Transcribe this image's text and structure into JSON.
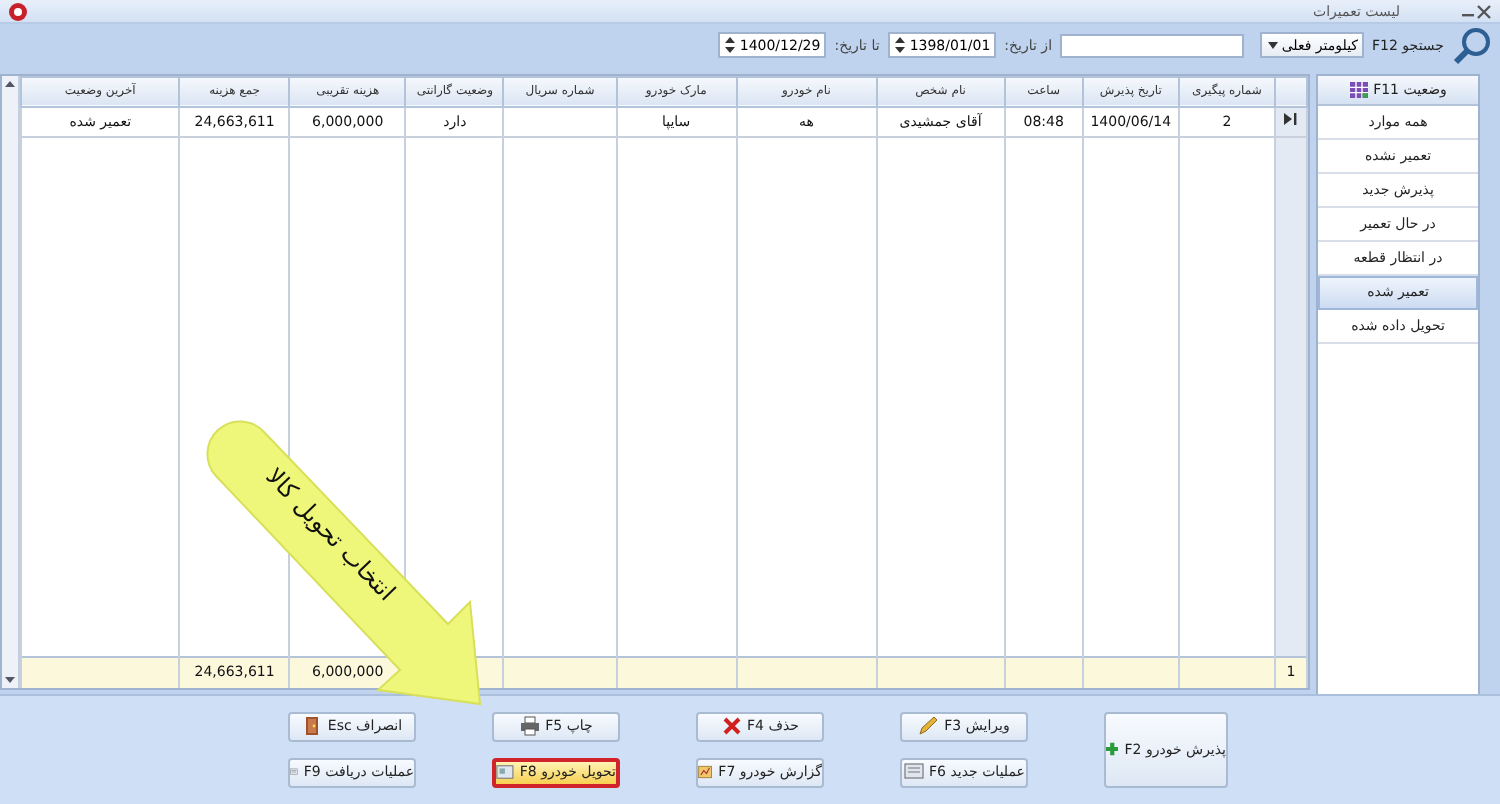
{
  "window": {
    "title": "لیست تعمیرات"
  },
  "toolbar": {
    "search_label": "جستجو F12",
    "filter_field": {
      "value": "کیلومتر فعلی"
    },
    "from_label": "از تاریخ:",
    "from_date": "1398/01/01",
    "to_label": "تا تاریخ:",
    "to_date": "1400/12/29"
  },
  "table": {
    "columns": [
      "شماره پیگیری",
      "تاریخ پذیرش",
      "ساعت",
      "نام شخص",
      "نام خودرو",
      "مارک خودرو",
      "شماره سریال",
      "وضعیت گارانتی",
      "هزینه تقریبی",
      "جمع هزینه",
      "آخرین وضعیت"
    ],
    "rows": [
      {
        "cells": [
          "2",
          "1400/06/14",
          "08:48",
          "آقای جمشیدی",
          "هه",
          "سایپا",
          null,
          "دارد",
          "6,000,000",
          "24,663,611",
          "تعمیر شده"
        ]
      }
    ],
    "totals": {
      "row_count": "1",
      "cells": [
        null,
        null,
        null,
        null,
        null,
        null,
        null,
        null,
        "6,000,000",
        "24,663,611",
        null
      ]
    }
  },
  "sidebar": {
    "title": "وضعیت F11",
    "items": [
      {
        "label": "همه موارد",
        "selected": false
      },
      {
        "label": "تعمیر نشده",
        "selected": false
      },
      {
        "label": "پذیرش جدید",
        "selected": false
      },
      {
        "label": "در حال تعمیر",
        "selected": false
      },
      {
        "label": "در انتظار قطعه",
        "selected": false
      },
      {
        "label": "تعمیر شده",
        "selected": true
      },
      {
        "label": "تحویل داده شده",
        "selected": false
      }
    ]
  },
  "buttons": {
    "main": {
      "label": "پذیرش خودرو F2"
    },
    "columns": [
      [
        {
          "label": "ویرایش F3",
          "highlighted": false
        },
        {
          "label": "عملیات جدید F6",
          "highlighted": false
        }
      ],
      [
        {
          "label": "حذف F4",
          "highlighted": false
        },
        {
          "label": "گزارش خودرو F7",
          "highlighted": false
        }
      ],
      [
        {
          "label": "چاپ F5",
          "highlighted": false
        },
        {
          "label": "تحویل خودرو F8",
          "highlighted": true
        }
      ],
      [
        {
          "label": "انصراف Esc",
          "highlighted": false
        },
        {
          "label": "عملیات دریافت F9",
          "highlighted": false
        }
      ]
    ]
  },
  "callout": {
    "text": "انتخاب تحویل کالا"
  }
}
